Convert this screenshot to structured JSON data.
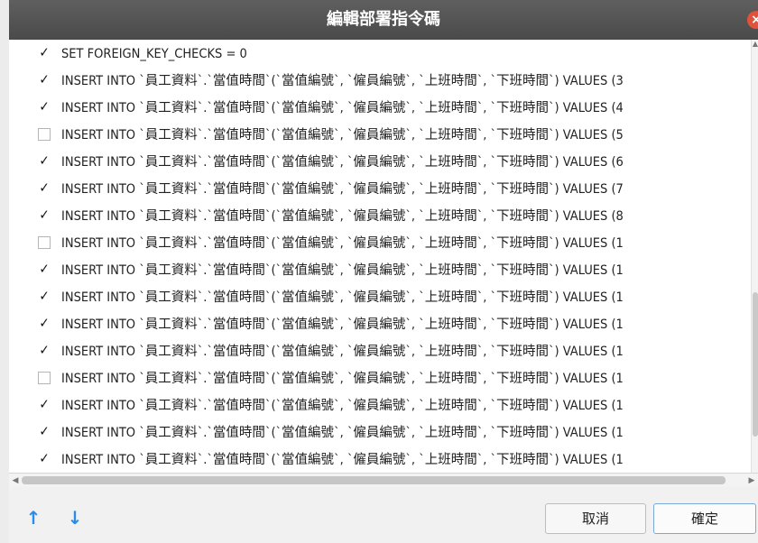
{
  "dialog": {
    "title": "編輯部署指令碼",
    "close_icon": "close-icon"
  },
  "rows": [
    {
      "checked": true,
      "text": "SET FOREIGN_KEY_CHECKS = 0"
    },
    {
      "checked": true,
      "text": "INSERT INTO `員工資料`.`當值時間`(`當值編號`, `僱員編號`, `上班時間`, `下班時間`) VALUES (3"
    },
    {
      "checked": true,
      "text": "INSERT INTO `員工資料`.`當值時間`(`當值編號`, `僱員編號`, `上班時間`, `下班時間`) VALUES (4"
    },
    {
      "checked": false,
      "text": "INSERT INTO `員工資料`.`當值時間`(`當值編號`, `僱員編號`, `上班時間`, `下班時間`) VALUES (5"
    },
    {
      "checked": true,
      "text": "INSERT INTO `員工資料`.`當值時間`(`當值編號`, `僱員編號`, `上班時間`, `下班時間`) VALUES (6"
    },
    {
      "checked": true,
      "text": "INSERT INTO `員工資料`.`當值時間`(`當值編號`, `僱員編號`, `上班時間`, `下班時間`) VALUES (7"
    },
    {
      "checked": true,
      "text": "INSERT INTO `員工資料`.`當值時間`(`當值編號`, `僱員編號`, `上班時間`, `下班時間`) VALUES (8"
    },
    {
      "checked": false,
      "text": "INSERT INTO `員工資料`.`當值時間`(`當值編號`, `僱員編號`, `上班時間`, `下班時間`) VALUES (1"
    },
    {
      "checked": true,
      "text": "INSERT INTO `員工資料`.`當值時間`(`當值編號`, `僱員編號`, `上班時間`, `下班時間`) VALUES (1"
    },
    {
      "checked": true,
      "text": "INSERT INTO `員工資料`.`當值時間`(`當值編號`, `僱員編號`, `上班時間`, `下班時間`) VALUES (1"
    },
    {
      "checked": true,
      "text": "INSERT INTO `員工資料`.`當值時間`(`當值編號`, `僱員編號`, `上班時間`, `下班時間`) VALUES (1"
    },
    {
      "checked": true,
      "text": "INSERT INTO `員工資料`.`當值時間`(`當值編號`, `僱員編號`, `上班時間`, `下班時間`) VALUES (1"
    },
    {
      "checked": false,
      "text": "INSERT INTO `員工資料`.`當值時間`(`當值編號`, `僱員編號`, `上班時間`, `下班時間`) VALUES (1"
    },
    {
      "checked": true,
      "text": "INSERT INTO `員工資料`.`當值時間`(`當值編號`, `僱員編號`, `上班時間`, `下班時間`) VALUES (1"
    },
    {
      "checked": true,
      "text": "INSERT INTO `員工資料`.`當值時間`(`當值編號`, `僱員編號`, `上班時間`, `下班時間`) VALUES (1"
    },
    {
      "checked": true,
      "text": "INSERT INTO `員工資料`.`當值時間`(`當值編號`, `僱員編號`, `上班時間`, `下班時間`) VALUES (1"
    }
  ],
  "footer": {
    "move_up_icon": "arrow-up-icon",
    "move_down_icon": "arrow-down-icon",
    "cancel_label": "取消",
    "ok_label": "確定"
  },
  "colors": {
    "titlebar": "#4f4f4f",
    "accent": "#2b8ce8",
    "close": "#e0533a"
  }
}
